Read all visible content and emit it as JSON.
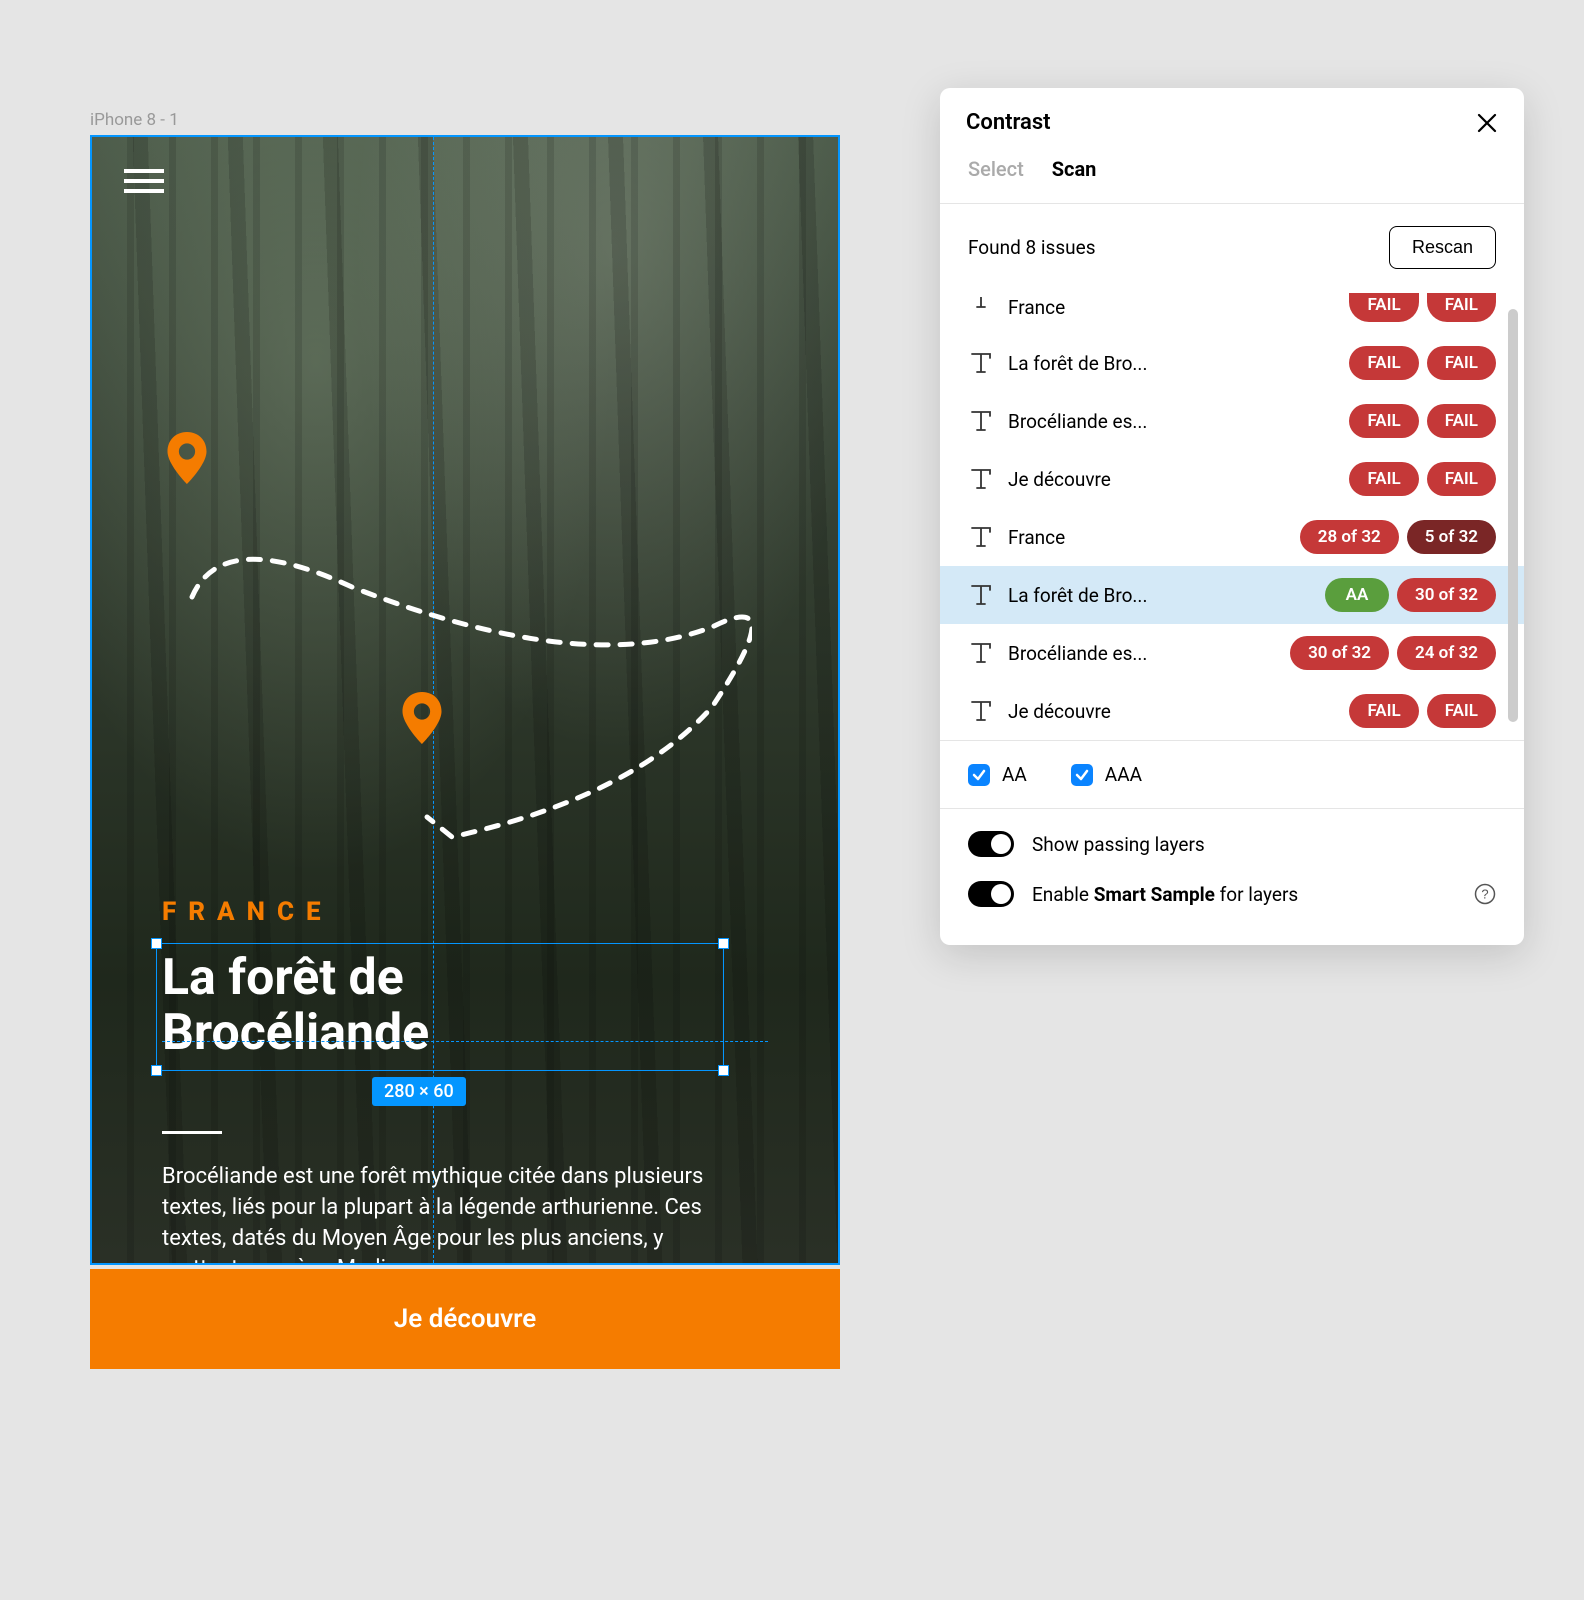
{
  "frame": {
    "label": "iPhone 8 - 1",
    "country": "FRANCE",
    "title": "La forêt de Brocéliande",
    "selection_size": "280 × 60",
    "body": "Brocéliande est une forêt mythique citée dans plusieurs textes, liés pour la plupart à la légende arthurienne. Ces textes, datés du Moyen Âge pour les plus anciens, y mettent en scène Merlin ..",
    "cta": "Je découvre"
  },
  "panel": {
    "title": "Contrast",
    "tabs": {
      "select": "Select",
      "scan": "Scan"
    },
    "found": "Found 8 issues",
    "rescan": "Rescan",
    "checks": {
      "aa": "AA",
      "aaa": "AAA"
    },
    "options": {
      "show_passing": "Show passing layers",
      "smart_sample_prefix": "Enable ",
      "smart_sample_bold": "Smart Sample",
      "smart_sample_suffix": " for layers"
    },
    "issues": [
      {
        "name": "France",
        "b1": "FAIL",
        "b1c": "fail",
        "b2": "FAIL",
        "b2c": "fail",
        "first": true
      },
      {
        "name": "La forêt de Bro...",
        "b1": "FAIL",
        "b1c": "fail",
        "b2": "FAIL",
        "b2c": "fail"
      },
      {
        "name": "Brocéliande es...",
        "b1": "FAIL",
        "b1c": "fail",
        "b2": "FAIL",
        "b2c": "fail"
      },
      {
        "name": "Je découvre",
        "b1": "FAIL",
        "b1c": "fail",
        "b2": "FAIL",
        "b2c": "fail"
      },
      {
        "name": "France",
        "b1": "28 of 32",
        "b1c": "partial",
        "b2": "5 of 32",
        "b2c": "dark"
      },
      {
        "name": "La forêt de Bro...",
        "b1": "AA",
        "b1c": "pass",
        "b2": "30 of 32",
        "b2c": "partial",
        "selected": true
      },
      {
        "name": "Brocéliande es...",
        "b1": "30 of 32",
        "b1c": "partial",
        "b2": "24 of 32",
        "b2c": "partial"
      },
      {
        "name": "Je découvre",
        "b1": "FAIL",
        "b1c": "fail",
        "b2": "FAIL",
        "b2c": "fail"
      }
    ]
  },
  "colors": {
    "accent_orange": "#f57c00",
    "selection_blue": "#0496ff",
    "fail_red": "#c53838",
    "pass_green": "#5a9e3d"
  }
}
